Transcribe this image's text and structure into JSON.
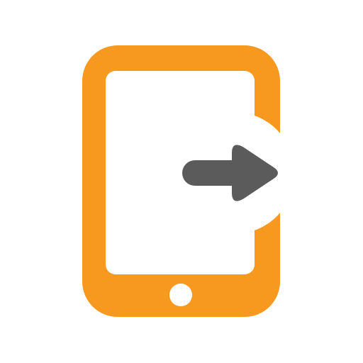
{
  "icon": {
    "name": "tablet-exit-icon",
    "device": "tablet-icon",
    "action": "arrow-right-icon"
  },
  "colors": {
    "tablet_frame": "#F7981F",
    "screen": "#FFFFFF",
    "home_button": "#FFFFFF",
    "arrow": "#5B5B5B",
    "background": "#FFFFFF"
  }
}
